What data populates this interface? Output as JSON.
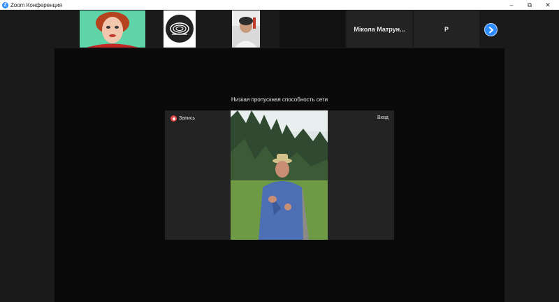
{
  "window": {
    "title": "Zoom Конференция"
  },
  "participants": [
    {
      "name": "Мікола Матрун..."
    },
    {
      "name": "Р"
    }
  ],
  "main": {
    "network_message": "Низкая пропускная способность сети",
    "recording_label": "Запись",
    "join_label": "Вход"
  },
  "colors": {
    "accent": "#2d8cff",
    "record": "#e64545"
  }
}
